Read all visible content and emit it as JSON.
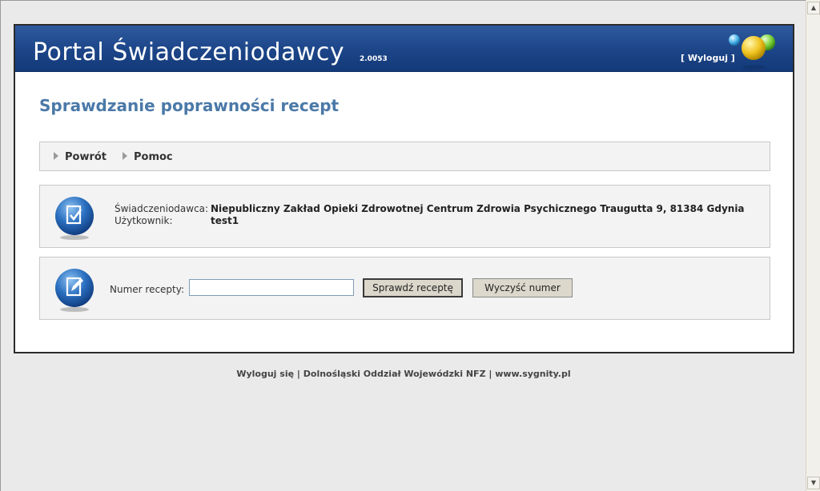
{
  "header": {
    "title": "Portal Świadczeniodawcy",
    "version": "2.0053",
    "logout": "[ Wyloguj ]"
  },
  "page": {
    "title": "Sprawdzanie poprawności recept"
  },
  "nav": {
    "back": "Powrót",
    "help": "Pomoc"
  },
  "info": {
    "provider_label": "Świadczeniodawca:",
    "provider_value": "Niepubliczny Zakład Opieki Zdrowotnej Centrum Zdrowia Psychicznego Traugutta 9, 81384 Gdynia",
    "user_label": "Użytkownik:",
    "user_value": "test1"
  },
  "form": {
    "rx_label": "Numer recepty:",
    "rx_value": "",
    "check_button": "Sprawdź receptę",
    "clear_button": "Wyczyść numer"
  },
  "footer": {
    "logout": "Wyloguj się",
    "sep1": " | ",
    "branch": "Dolnośląski Oddział Wojewódzki NFZ",
    "sep2": " | ",
    "site": "www.sygnity.pl"
  },
  "colors": {
    "banner": "#1c4588",
    "page_title": "#4b79a8",
    "panel_bg": "#f3f3f3"
  },
  "icons": {
    "document_check": "document-check-icon",
    "document_edit": "document-edit-icon",
    "scroll_up": "scroll-up-arrow-icon",
    "scroll_down": "scroll-down-arrow-icon"
  }
}
